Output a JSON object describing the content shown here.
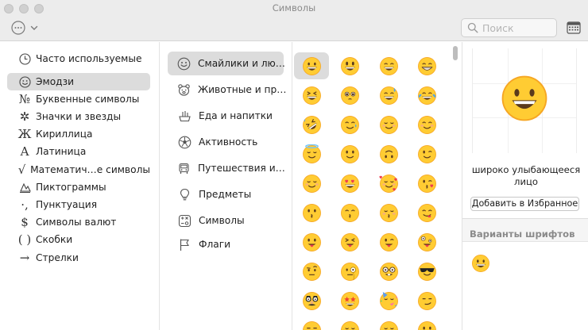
{
  "window": {
    "title": "Символы"
  },
  "toolbar": {
    "search_placeholder": "Поиск",
    "search_value": ""
  },
  "sidebar": {
    "selected_index": 1,
    "items": [
      {
        "label": "Часто используемые",
        "icon": "clock-icon"
      },
      {
        "label": "Эмодзи",
        "icon": "smiley-outline-icon"
      },
      {
        "label": "Буквенные символы",
        "icon": "numero-icon",
        "glyph": "№"
      },
      {
        "label": "Значки и звезды",
        "icon": "asterisk-icon",
        "glyph": "✲"
      },
      {
        "label": "Кириллица",
        "icon": "cyrillic-icon",
        "glyph": "Ж"
      },
      {
        "label": "Латиница",
        "icon": "latin-icon",
        "glyph": "A"
      },
      {
        "label": "Математич…е символы",
        "icon": "square-root-icon",
        "glyph": "√"
      },
      {
        "label": "Пиктограммы",
        "icon": "pictograph-icon"
      },
      {
        "label": "Пунктуация",
        "icon": "punctuation-icon",
        "glyph": "·,"
      },
      {
        "label": "Символы валют",
        "icon": "dollar-icon",
        "glyph": "$"
      },
      {
        "label": "Скобки",
        "icon": "parentheses-icon",
        "glyph": "( )"
      },
      {
        "label": "Стрелки",
        "icon": "arrow-right-icon",
        "glyph": "→"
      }
    ]
  },
  "categories": {
    "selected_index": 0,
    "items": [
      {
        "label": "Смайлики и лю…",
        "icon": "smiley-outline-icon"
      },
      {
        "label": "Животные и пр…",
        "icon": "bear-icon"
      },
      {
        "label": "Еда и напитки",
        "icon": "food-icon"
      },
      {
        "label": "Активность",
        "icon": "soccer-ball-icon"
      },
      {
        "label": "Путешествия и…",
        "icon": "car-icon"
      },
      {
        "label": "Предметы",
        "icon": "lightbulb-icon"
      },
      {
        "label": "Символы",
        "icon": "symbols-icon"
      },
      {
        "label": "Флаги",
        "icon": "flag-icon"
      }
    ]
  },
  "emoji_grid": {
    "selected_index": 0,
    "rows": [
      [
        "grinning-face",
        "grinning-face-big-eyes",
        "grinning-face-smiling-eyes",
        "beaming-face"
      ],
      [
        "squinting-face",
        "face-holding-back-tears",
        "grinning-face-sweat",
        "face-with-tears-of-joy"
      ],
      [
        "rolling-on-floor-laughing",
        "smiling-face-with-tear",
        "smiling-face",
        "smiling-face-with-smiling-eyes"
      ],
      [
        "smiling-face-with-halo",
        "slightly-smiling-face",
        "upside-down-face",
        "winking-face"
      ],
      [
        "relieved-face",
        "smiling-face-with-heart-eyes",
        "smiling-face-with-hearts",
        "face-blowing-kiss"
      ],
      [
        "kissing-face",
        "kissing-face-smiling-eyes",
        "kissing-face-closed-eyes",
        "face-savoring-food"
      ],
      [
        "face-with-tongue",
        "squinting-face-with-tongue",
        "winking-face-with-tongue",
        "zany-face"
      ],
      [
        "face-with-raised-eyebrow",
        "face-with-monocle",
        "nerd-face",
        "smiling-face-with-sunglasses"
      ],
      [
        "disguised-face",
        "star-struck",
        "partying-face",
        "smirking-face"
      ],
      [
        "unamused-face",
        "disappointed-face",
        "pensive-face",
        "worried-face"
      ]
    ]
  },
  "detail": {
    "emoji": "grinning-face",
    "name": "широко улыбающееся лицо",
    "favorite_button": "Добавить в Избранное",
    "variants_label": "Варианты шрифтов",
    "variants": [
      "grinning-face"
    ]
  },
  "colors": {
    "emoji_yellow": "#ffcc33",
    "emoji_orange": "#f6a623",
    "emoji_dark": "#5a3a1c",
    "selection": "#dcdcdc",
    "heart_red": "#ef3b4e",
    "tear_blue": "#4aa3f0"
  }
}
